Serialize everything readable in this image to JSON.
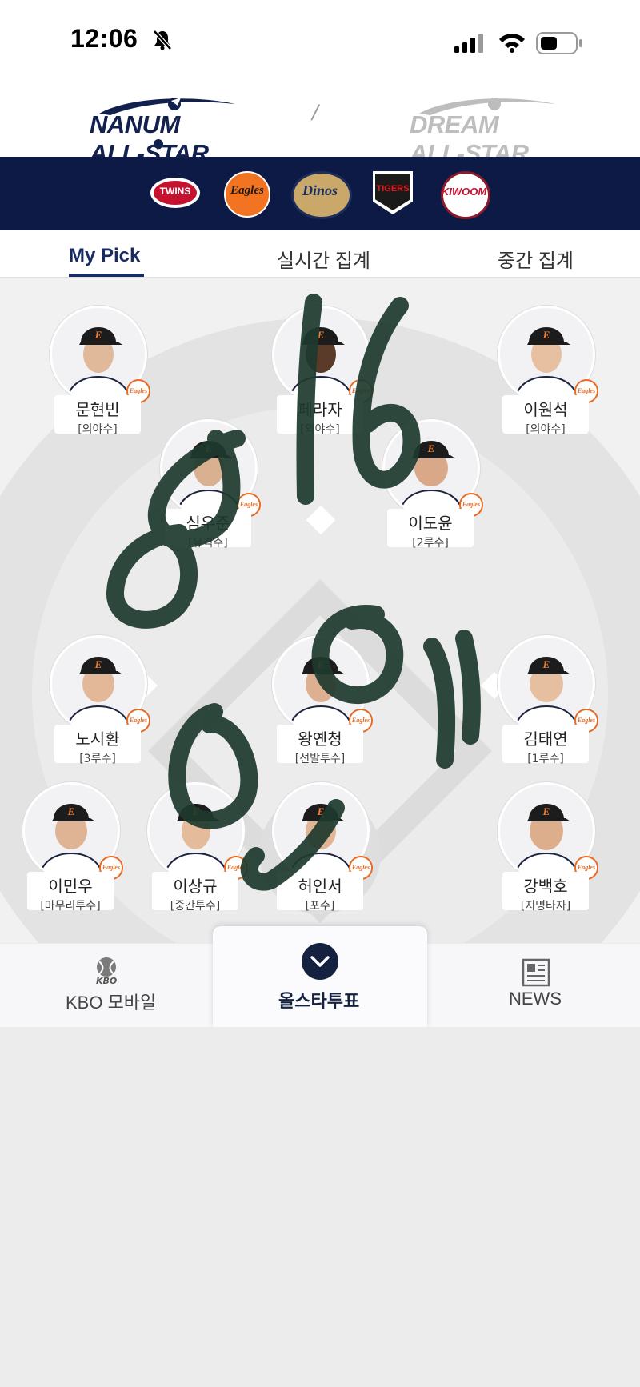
{
  "status_bar": {
    "time": "12:06",
    "silent": "bell-slash-icon"
  },
  "header": {
    "left_logo": "NANUM ALL-STAR",
    "separator": "/",
    "right_logo": "DREAM ALL-STAR"
  },
  "teams": [
    "TWINS",
    "Eagles",
    "Dinos",
    "TIGERS",
    "KIWOOM"
  ],
  "tabs": [
    {
      "label": "My Pick",
      "active": true
    },
    {
      "label": "실시간 집계",
      "active": false
    },
    {
      "label": "중간 집계",
      "active": false
    }
  ],
  "players": [
    {
      "name": "문현빈",
      "position": "[외야수]"
    },
    {
      "name": "페라자",
      "position": "[외야수]"
    },
    {
      "name": "이원석",
      "position": "[외야수]"
    },
    {
      "name": "심우준",
      "position": "[유격수]"
    },
    {
      "name": "이도윤",
      "position": "[2루수]"
    },
    {
      "name": "노시환",
      "position": "[3루수]"
    },
    {
      "name": "왕옌청",
      "position": "[선발투수]"
    },
    {
      "name": "김태연",
      "position": "[1루수]"
    },
    {
      "name": "이민우",
      "position": "[마무리투수]"
    },
    {
      "name": "이상규",
      "position": "[중간투수]"
    },
    {
      "name": "허인서",
      "position": "[포수]"
    },
    {
      "name": "강백호",
      "position": "[지명타자]"
    }
  ],
  "badge_text": "Eagles",
  "nav": {
    "kbo_small": "KBO",
    "kbo_label": "KBO 모바일",
    "vote_label": "올스타투표",
    "news_label": "NEWS"
  },
  "colors": {
    "navy": "#0d1a46",
    "accent": "#182a63",
    "eagles_orange": "#e86a23",
    "scribble": "#1e3a2e"
  }
}
